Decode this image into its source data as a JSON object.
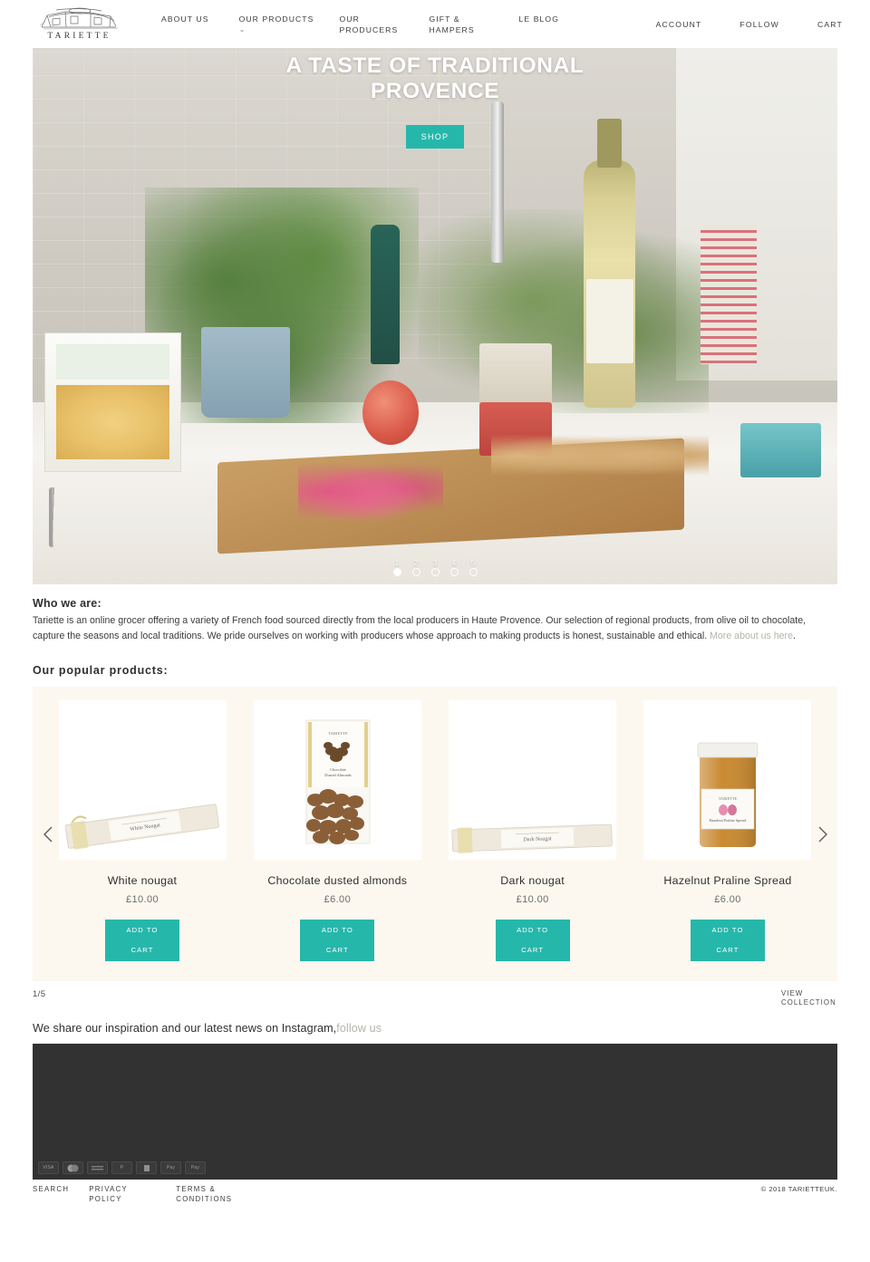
{
  "header": {
    "logo": {
      "wordmark": "TARIETTE",
      "icon": "farmhouse-line-drawing"
    },
    "nav": [
      {
        "label": "ABOUT US",
        "caret": false
      },
      {
        "label": "OUR PRODUCTS",
        "caret": true,
        "caret_glyph": "⌄"
      },
      {
        "label": "OUR PRODUCERS",
        "caret": false
      },
      {
        "label": "GIFT & HAMPERS",
        "caret": false
      },
      {
        "label": "LE BLOG",
        "caret": false
      }
    ],
    "util": [
      {
        "label": "ACCOUNT"
      },
      {
        "label": "FOLLOW"
      },
      {
        "label": "CART"
      }
    ]
  },
  "hero": {
    "title": "A TASTE OF TRADITIONAL PROVENCE",
    "cta": "SHOP",
    "cta_color": "#26b7ab",
    "slides": [
      "1",
      "2",
      "3",
      "4",
      "5"
    ],
    "active_slide": 1
  },
  "who": {
    "heading": "Who we are:",
    "body_1": "Tariette is an online grocer offering a variety of French food sourced directly from the local producers in Haute Provence. Our selection of regional products, from olive oil to chocolate, capture the seasons and local traditions. We pride ourselves on working with producers whose approach to making products is honest, sustainable and ethical. ",
    "link": "More about us here",
    "body_2": "."
  },
  "products_section": {
    "heading": "Our popular products:",
    "add_to_cart_line1": "ADD TO",
    "add_to_cart_line2": "CART",
    "prev_icon": "chevron-left-icon",
    "next_icon": "chevron-right-icon",
    "counter": "1/5",
    "view_collection": "VIEW COLLECTION",
    "items": [
      {
        "name": "White nougat",
        "price": "£10.00",
        "image": "white-nougat-bar"
      },
      {
        "name": "Chocolate dusted almonds",
        "price": "£6.00",
        "image": "chocolate-dusted-almonds-bag"
      },
      {
        "name": "Dark nougat",
        "price": "£10.00",
        "image": "dark-nougat-bar"
      },
      {
        "name": "Hazelnut Praline Spread",
        "price": "£6.00",
        "image": "hazelnut-praline-spread-jar"
      }
    ]
  },
  "instagram": {
    "text": "We share our inspiration and our latest news on Instagram,",
    "link": "follow us"
  },
  "payments": [
    {
      "name": "visa",
      "label": "VISA"
    },
    {
      "name": "mastercard",
      "label": ""
    },
    {
      "name": "amex",
      "label": ""
    },
    {
      "name": "paypal",
      "label": "P"
    },
    {
      "name": "maestro",
      "label": ""
    },
    {
      "name": "apple-pay",
      "label": "Pay"
    },
    {
      "name": "google-pay",
      "label": "Pay"
    }
  ],
  "footer": {
    "links": [
      {
        "label": "SEARCH"
      },
      {
        "label": "PRIVACY POLICY"
      },
      {
        "label": "TERMS & CONDITIONS"
      }
    ],
    "copyright": "© 2018 TARIETTEUK."
  }
}
